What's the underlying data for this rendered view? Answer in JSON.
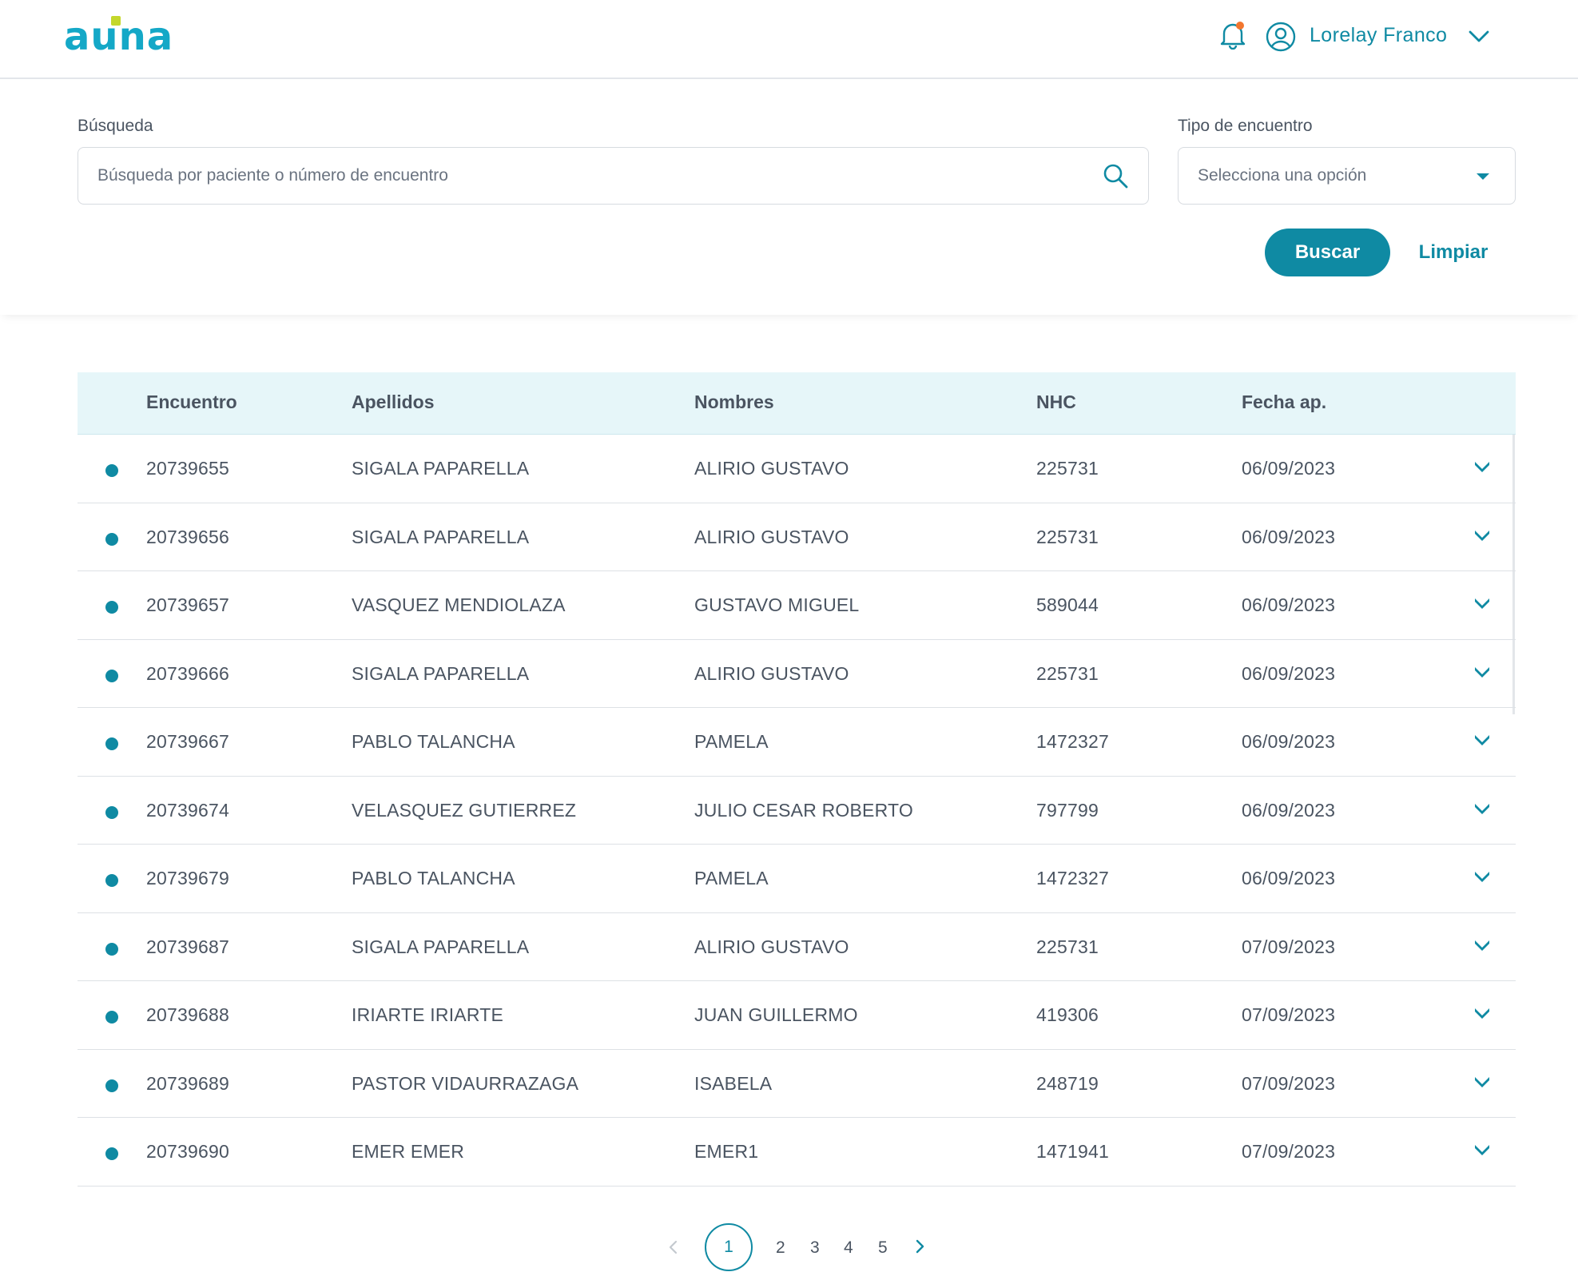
{
  "brand": {
    "logo_text_a": "a",
    "logo_text_u": "u",
    "logo_text_na": "na"
  },
  "header": {
    "user_name": "Lorelay Franco",
    "icons": {
      "notifications": "bell-icon",
      "user": "user-circle-icon",
      "menu": "chevron-down-icon"
    },
    "colors": {
      "accent": "#0f8aa3",
      "brand": "#14a8c7",
      "logo_accent": "#c4d72b",
      "notification_dot": "#f2762e"
    }
  },
  "filters": {
    "search_label": "Búsqueda",
    "search_placeholder": "Búsqueda por paciente o número de encuentro",
    "search_value": "",
    "type_label": "Tipo de encuentro",
    "type_value": "Selecciona una opción",
    "buscar_label": "Buscar",
    "limpiar_label": "Limpiar"
  },
  "table": {
    "columns": [
      "Encuentro",
      "Apellidos",
      "Nombres",
      "NHC",
      "Fecha ap."
    ],
    "rows": [
      [
        "20739655",
        "SIGALA PAPARELLA",
        "ALIRIO GUSTAVO",
        "225731",
        "06/09/2023"
      ],
      [
        "20739656",
        "SIGALA PAPARELLA",
        "ALIRIO GUSTAVO",
        "225731",
        "06/09/2023"
      ],
      [
        "20739657",
        "VASQUEZ MENDIOLAZA",
        "GUSTAVO MIGUEL",
        "589044",
        "06/09/2023"
      ],
      [
        "20739666",
        "SIGALA PAPARELLA",
        "ALIRIO GUSTAVO",
        "225731",
        "06/09/2023"
      ],
      [
        "20739667",
        "PABLO TALANCHA",
        "PAMELA",
        "1472327",
        "06/09/2023"
      ],
      [
        "20739674",
        "VELASQUEZ GUTIERREZ",
        "JULIO CESAR ROBERTO",
        "797799",
        "06/09/2023"
      ],
      [
        "20739679",
        "PABLO TALANCHA",
        "PAMELA",
        "1472327",
        "06/09/2023"
      ],
      [
        "20739687",
        "SIGALA PAPARELLA",
        "ALIRIO GUSTAVO",
        "225731",
        "07/09/2023"
      ],
      [
        "20739688",
        "IRIARTE IRIARTE",
        "JUAN GUILLERMO",
        "419306",
        "07/09/2023"
      ],
      [
        "20739689",
        "PASTOR VIDAURRAZAGA",
        "ISABELA",
        "248719",
        "07/09/2023"
      ],
      [
        "20739690",
        "EMER EMER",
        "EMER1",
        "1471941",
        "07/09/2023"
      ]
    ]
  },
  "pagination": {
    "current": "1",
    "pages": [
      "2",
      "3",
      "4",
      "5"
    ]
  }
}
